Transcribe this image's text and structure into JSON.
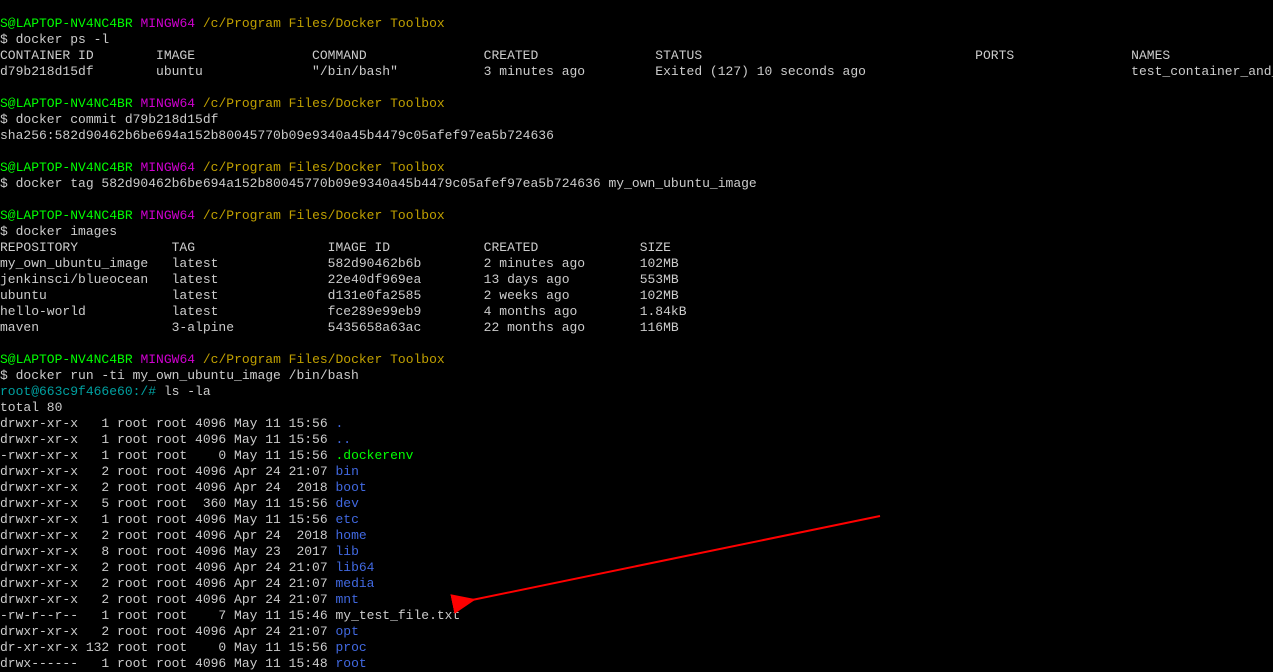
{
  "prompt_user": "S@LAPTOP-NV4NC4BR",
  "prompt_sys": "MINGW64",
  "prompt_path": "/c/Program Files/Docker Toolbox",
  "dollar": "$",
  "blocks": {
    "b1_cmd": "docker ps -l",
    "b1_hdr_id": "CONTAINER ID",
    "b1_hdr_image": "IMAGE",
    "b1_hdr_cmd": "COMMAND",
    "b1_hdr_created": "CREATED",
    "b1_hdr_status": "STATUS",
    "b1_hdr_ports": "PORTS",
    "b1_hdr_names": "NAMES",
    "b1_r_id": "d79b218d15df",
    "b1_r_image": "ubuntu",
    "b1_r_cmd": "\"/bin/bash\"",
    "b1_r_created": "3 minutes ago",
    "b1_r_status": "Exited (127) 10 seconds ago",
    "b1_r_ports": "",
    "b1_r_names": "test_container_and_image_test",
    "b2_cmd": "docker commit d79b218d15df",
    "b2_sha": "sha256:582d90462b6be694a152b80045770b09e9340a45b4479c05afef97ea5b724636",
    "b3_cmd": "docker tag 582d90462b6be694a152b80045770b09e9340a45b4479c05afef97ea5b724636 my_own_ubuntu_image",
    "b4_cmd": "docker images",
    "b4_h_repo": "REPOSITORY",
    "b4_h_tag": "TAG",
    "b4_h_id": "IMAGE ID",
    "b4_h_created": "CREATED",
    "b4_h_size": "SIZE",
    "b4_r1_repo": "my_own_ubuntu_image",
    "b4_r1_tag": "latest",
    "b4_r1_id": "582d90462b6b",
    "b4_r1_created": "2 minutes ago",
    "b4_r1_size": "102MB",
    "b4_r2_repo": "jenkinsci/blueocean",
    "b4_r2_tag": "latest",
    "b4_r2_id": "22e40df969ea",
    "b4_r2_created": "13 days ago",
    "b4_r2_size": "553MB",
    "b4_r3_repo": "ubuntu",
    "b4_r3_tag": "latest",
    "b4_r3_id": "d131e0fa2585",
    "b4_r3_created": "2 weeks ago",
    "b4_r3_size": "102MB",
    "b4_r4_repo": "hello-world",
    "b4_r4_tag": "latest",
    "b4_r4_id": "fce289e99eb9",
    "b4_r4_created": "4 months ago",
    "b4_r4_size": "1.84kB",
    "b4_r5_repo": "maven",
    "b4_r5_tag": "3-alpine",
    "b4_r5_id": "5435658a63ac",
    "b4_r5_created": "22 months ago",
    "b4_r5_size": "116MB",
    "b5_cmd": "docker run -ti my_own_ubuntu_image /bin/bash",
    "b5_root_prompt": "root@663c9f466e60:/#",
    "b5_ls_cmd": "ls -la",
    "b5_total": "total 80",
    "ls": [
      {
        "perm": "drwxr-xr-x",
        "l": "  1",
        "o": "root",
        "g": "root",
        "sz": "4096",
        "dt": "May 11 15:56",
        "nm": ".",
        "cls": "blue"
      },
      {
        "perm": "drwxr-xr-x",
        "l": "  1",
        "o": "root",
        "g": "root",
        "sz": "4096",
        "dt": "May 11 15:56",
        "nm": "..",
        "cls": "blue"
      },
      {
        "perm": "-rwxr-xr-x",
        "l": "  1",
        "o": "root",
        "g": "root",
        "sz": "   0",
        "dt": "May 11 15:56",
        "nm": ".dockerenv",
        "cls": "green"
      },
      {
        "perm": "drwxr-xr-x",
        "l": "  2",
        "o": "root",
        "g": "root",
        "sz": "4096",
        "dt": "Apr 24 21:07",
        "nm": "bin",
        "cls": "blue"
      },
      {
        "perm": "drwxr-xr-x",
        "l": "  2",
        "o": "root",
        "g": "root",
        "sz": "4096",
        "dt": "Apr 24  2018",
        "nm": "boot",
        "cls": "blue"
      },
      {
        "perm": "drwxr-xr-x",
        "l": "  5",
        "o": "root",
        "g": "root",
        "sz": " 360",
        "dt": "May 11 15:56",
        "nm": "dev",
        "cls": "blue"
      },
      {
        "perm": "drwxr-xr-x",
        "l": "  1",
        "o": "root",
        "g": "root",
        "sz": "4096",
        "dt": "May 11 15:56",
        "nm": "etc",
        "cls": "blue"
      },
      {
        "perm": "drwxr-xr-x",
        "l": "  2",
        "o": "root",
        "g": "root",
        "sz": "4096",
        "dt": "Apr 24  2018",
        "nm": "home",
        "cls": "blue"
      },
      {
        "perm": "drwxr-xr-x",
        "l": "  8",
        "o": "root",
        "g": "root",
        "sz": "4096",
        "dt": "May 23  2017",
        "nm": "lib",
        "cls": "blue"
      },
      {
        "perm": "drwxr-xr-x",
        "l": "  2",
        "o": "root",
        "g": "root",
        "sz": "4096",
        "dt": "Apr 24 21:07",
        "nm": "lib64",
        "cls": "blue"
      },
      {
        "perm": "drwxr-xr-x",
        "l": "  2",
        "o": "root",
        "g": "root",
        "sz": "4096",
        "dt": "Apr 24 21:07",
        "nm": "media",
        "cls": "blue"
      },
      {
        "perm": "drwxr-xr-x",
        "l": "  2",
        "o": "root",
        "g": "root",
        "sz": "4096",
        "dt": "Apr 24 21:07",
        "nm": "mnt",
        "cls": "blue"
      },
      {
        "perm": "-rw-r--r--",
        "l": "  1",
        "o": "root",
        "g": "root",
        "sz": "   7",
        "dt": "May 11 15:46",
        "nm": "my_test_file.txt",
        "cls": "white"
      },
      {
        "perm": "drwxr-xr-x",
        "l": "  2",
        "o": "root",
        "g": "root",
        "sz": "4096",
        "dt": "Apr 24 21:07",
        "nm": "opt",
        "cls": "blue"
      },
      {
        "perm": "dr-xr-xr-x",
        "l": "132",
        "o": "root",
        "g": "root",
        "sz": "   0",
        "dt": "May 11 15:56",
        "nm": "proc",
        "cls": "blue"
      },
      {
        "perm": "drwx------",
        "l": "  1",
        "o": "root",
        "g": "root",
        "sz": "4096",
        "dt": "May 11 15:48",
        "nm": "root",
        "cls": "blue"
      }
    ]
  }
}
